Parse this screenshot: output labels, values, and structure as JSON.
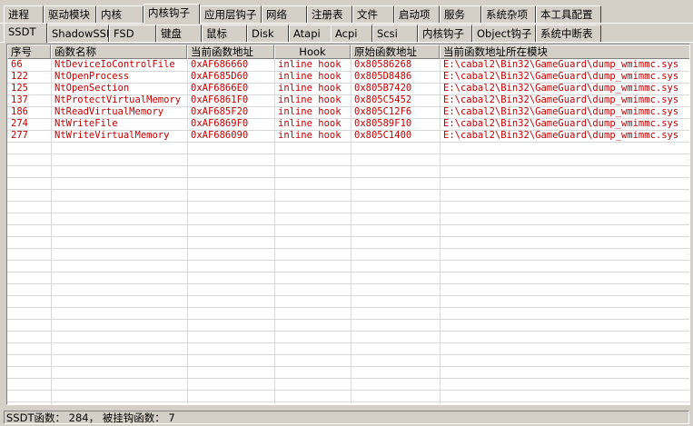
{
  "main_tabs": [
    "进程",
    "驱动模块",
    "内核",
    "内核钩子",
    "应用层钩子",
    "网络",
    "注册表",
    "文件",
    "启动项",
    "服务",
    "系统杂项",
    "本工具配置"
  ],
  "main_active": 3,
  "sub_tabs": [
    "SSDT",
    "ShadowSSDT",
    "FSD",
    "键盘",
    "鼠标",
    "Disk",
    "Atapi",
    "Acpi",
    "Scsi",
    "内核钩子",
    "Object钩子",
    "系统中断表"
  ],
  "sub_active": 0,
  "columns": [
    "序号",
    "函数名称",
    "当前函数地址",
    "Hook",
    "原始函数地址",
    "当前函数地址所在模块"
  ],
  "rows": [
    [
      "66",
      "NtDeviceIoControlFile",
      "0xAF686660",
      "inline hook",
      "0x80586268",
      "E:\\cabal2\\Bin32\\GameGuard\\dump_wmimmc.sys"
    ],
    [
      "122",
      "NtOpenProcess",
      "0xAF685D60",
      "inline hook",
      "0x805D8486",
      "E:\\cabal2\\Bin32\\GameGuard\\dump_wmimmc.sys"
    ],
    [
      "125",
      "NtOpenSection",
      "0xAF6866E0",
      "inline hook",
      "0x805B7420",
      "E:\\cabal2\\Bin32\\GameGuard\\dump_wmimmc.sys"
    ],
    [
      "137",
      "NtProtectVirtualMemory",
      "0xAF6861F0",
      "inline hook",
      "0x805C5452",
      "E:\\cabal2\\Bin32\\GameGuard\\dump_wmimmc.sys"
    ],
    [
      "186",
      "NtReadVirtualMemory",
      "0xAF685F20",
      "inline hook",
      "0x805C12F6",
      "E:\\cabal2\\Bin32\\GameGuard\\dump_wmimmc.sys"
    ],
    [
      "274",
      "NtWriteFile",
      "0xAF6869F0",
      "inline hook",
      "0x80589F10",
      "E:\\cabal2\\Bin32\\GameGuard\\dump_wmimmc.sys"
    ],
    [
      "277",
      "NtWriteVirtualMemory",
      "0xAF686090",
      "inline hook",
      "0x805C1400",
      "E:\\cabal2\\Bin32\\GameGuard\\dump_wmimmc.sys"
    ]
  ],
  "status": "SSDT函数： 284， 被挂钩函数： 7",
  "colors": {
    "text_hook": "#c00000",
    "face": "#d4d0c8"
  }
}
